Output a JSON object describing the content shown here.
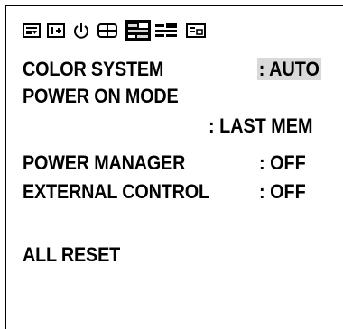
{
  "tabs": [
    {
      "icon": "picture-icon"
    },
    {
      "icon": "info-plus-icon"
    },
    {
      "icon": "power-icon"
    },
    {
      "icon": "grid-icon"
    },
    {
      "icon": "settings-sliders-icon",
      "selected": true
    },
    {
      "icon": "sliders-icon"
    },
    {
      "icon": "input-icon"
    }
  ],
  "menu": {
    "color_system_label": "COLOR SYSTEM",
    "color_system_value": ": AUTO",
    "power_on_mode_label": "POWER ON MODE",
    "power_on_mode_value": ": LAST MEM",
    "power_manager_label": "POWER MANAGER",
    "power_manager_value": ": OFF",
    "external_control_label": "EXTERNAL CONTROL",
    "external_control_value": ": OFF",
    "all_reset_label": "ALL RESET"
  },
  "colors": {
    "highlight": "#d9d9d9",
    "foreground": "#000000",
    "background": "#ffffff"
  }
}
